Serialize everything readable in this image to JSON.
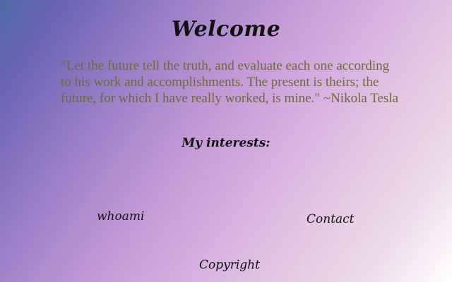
{
  "page": {
    "heading": "Welcome",
    "quote": "\"Let the future tell the truth, and evaluate each one according to his work and accomplishments. The present is theirs; the future, for which I have really worked, is mine.\" ~Nikola Tesla",
    "interests_label": "My interests:"
  },
  "nav": {
    "whoami": "whoami",
    "contact": "Contact",
    "copyright": "Copyright"
  },
  "colors": {
    "quote_text": "#6b6b3c",
    "heading_text": "#111111",
    "gradient_start": "#4f6aa6",
    "gradient_mid": "#c49ad6",
    "gradient_end": "#ffffff"
  }
}
